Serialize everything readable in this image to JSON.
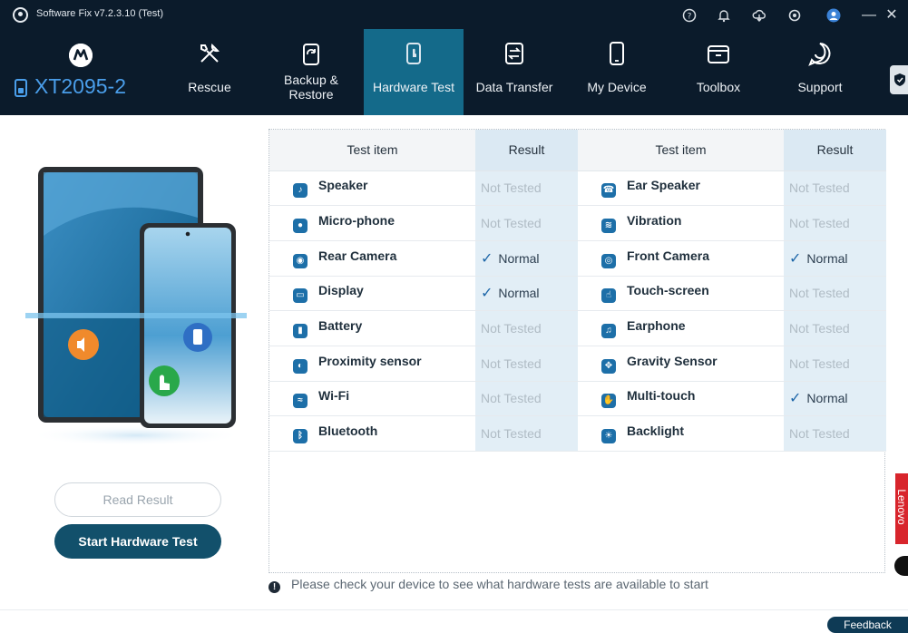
{
  "titlebar": {
    "title": "Software Fix v7.2.3.10 (Test)",
    "icons": [
      "help-icon",
      "bell-icon",
      "cloud-download-icon",
      "settings-icon",
      "user-icon",
      "minimize-icon",
      "close-icon"
    ]
  },
  "device": {
    "name": "XT2095-2"
  },
  "nav": {
    "items": [
      {
        "label": "Rescue",
        "icon": "wrench-screwdriver-icon"
      },
      {
        "label": "Backup & Restore",
        "icon": "backup-icon"
      },
      {
        "label": "Hardware Test",
        "icon": "touch-phone-icon",
        "active": true
      },
      {
        "label": "Data Transfer",
        "icon": "transfer-icon"
      },
      {
        "label": "My Device",
        "icon": "phone-icon"
      },
      {
        "label": "Toolbox",
        "icon": "toolbox-icon"
      },
      {
        "label": "Support",
        "icon": "chat-icon"
      }
    ]
  },
  "actions": {
    "read_result": "Read Result",
    "start_test": "Start Hardware Test"
  },
  "table": {
    "headers": [
      "Test item",
      "Result",
      "Test item",
      "Result"
    ],
    "rows": [
      {
        "left": {
          "item": "Speaker",
          "icon": "speaker-icon",
          "result": "Not Tested",
          "ok": false
        },
        "right": {
          "item": "Ear Speaker",
          "icon": "ear-speaker-icon",
          "result": "Not Tested",
          "ok": false
        }
      },
      {
        "left": {
          "item": "Micro-phone",
          "icon": "microphone-icon",
          "result": "Not Tested",
          "ok": false
        },
        "right": {
          "item": "Vibration",
          "icon": "vibration-icon",
          "result": "Not Tested",
          "ok": false
        }
      },
      {
        "left": {
          "item": "Rear Camera",
          "icon": "rear-camera-icon",
          "result": "Normal",
          "ok": true
        },
        "right": {
          "item": "Front Camera",
          "icon": "front-camera-icon",
          "result": "Normal",
          "ok": true
        }
      },
      {
        "left": {
          "item": "Display",
          "icon": "display-icon",
          "result": "Normal",
          "ok": true
        },
        "right": {
          "item": "Touch-screen",
          "icon": "touch-icon",
          "result": "Not Tested",
          "ok": false
        }
      },
      {
        "left": {
          "item": "Battery",
          "icon": "battery-icon",
          "result": "Not Tested",
          "ok": false
        },
        "right": {
          "item": "Earphone",
          "icon": "earphone-icon",
          "result": "Not Tested",
          "ok": false
        }
      },
      {
        "left": {
          "item": "Proximity sensor",
          "icon": "proximity-icon",
          "result": "Not Tested",
          "ok": false
        },
        "right": {
          "item": "Gravity Sensor",
          "icon": "gravity-icon",
          "result": "Not Tested",
          "ok": false
        }
      },
      {
        "left": {
          "item": "Wi-Fi",
          "icon": "wifi-icon",
          "result": "Not Tested",
          "ok": false
        },
        "right": {
          "item": "Multi-touch",
          "icon": "multitouch-icon",
          "result": "Normal",
          "ok": true
        }
      },
      {
        "left": {
          "item": "Bluetooth",
          "icon": "bluetooth-icon",
          "result": "Not Tested",
          "ok": false
        },
        "right": {
          "item": "Backlight",
          "icon": "backlight-icon",
          "result": "Not Tested",
          "ok": false
        }
      }
    ]
  },
  "info_text": "Please check your device to see what hardware tests are available to start",
  "feedback_label": "Feedback",
  "brand_tab": "Lenovo",
  "colors": {
    "navbar": "#0b1b2b",
    "active_tab": "#146a8a",
    "accent": "#4a9eea",
    "primary_button": "#12506b",
    "result_col": "#e2eef6"
  }
}
